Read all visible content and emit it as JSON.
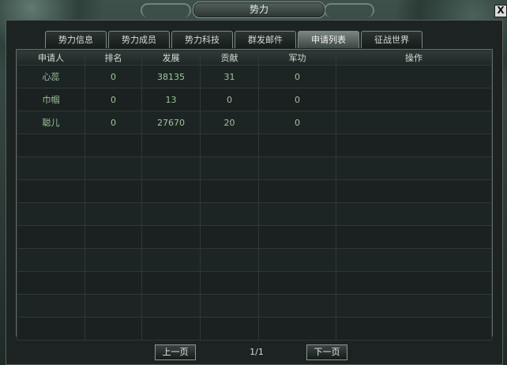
{
  "window": {
    "title": "势力",
    "close_glyph": "X"
  },
  "tabs": [
    {
      "label": "势力信息",
      "active": false
    },
    {
      "label": "势力成员",
      "active": false
    },
    {
      "label": "势力科技",
      "active": false
    },
    {
      "label": "群发邮件",
      "active": false
    },
    {
      "label": "申请列表",
      "active": true
    },
    {
      "label": "征战世界",
      "active": false
    }
  ],
  "table": {
    "headers": [
      "申请人",
      "排名",
      "发展",
      "贡献",
      "军功",
      "操作"
    ],
    "rows": [
      [
        "心蕊",
        "0",
        "38135",
        "31",
        "0",
        ""
      ],
      [
        "巾帼",
        "0",
        "13",
        "0",
        "0",
        ""
      ],
      [
        "聪儿",
        "0",
        "27670",
        "20",
        "0",
        ""
      ]
    ]
  },
  "pager": {
    "prev_label": "上一页",
    "next_label": "下一页",
    "page_info": "1/1"
  },
  "colors": {
    "row_text": "#9ec49a",
    "header_text": "#d7dbd3",
    "panel_bg": "#1c2322"
  }
}
